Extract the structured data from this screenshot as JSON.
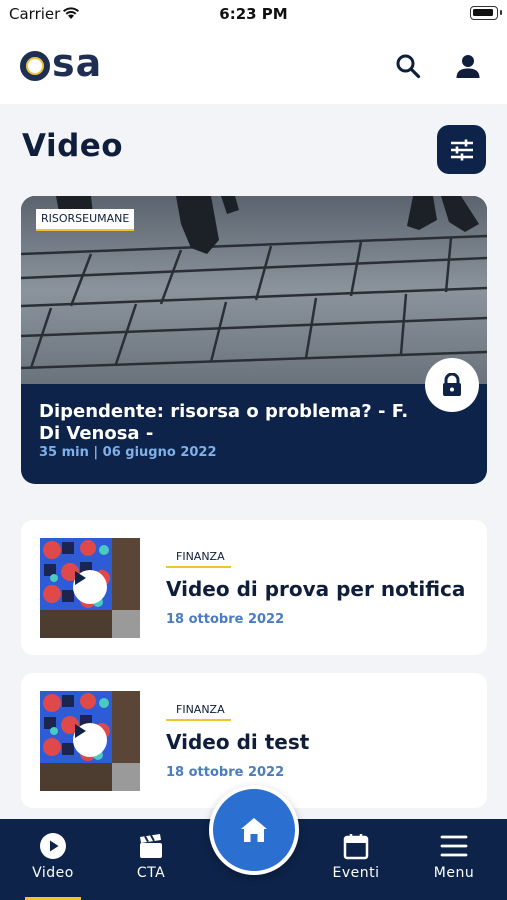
{
  "status_bar": {
    "carrier": "Carrier",
    "time": "6:23 PM"
  },
  "header": {
    "logo_text": "sa"
  },
  "page": {
    "title": "Video"
  },
  "featured": {
    "tag": "RISORSEUMANE",
    "title": "Dipendente: risorsa o problema? - F. Di Venosa -",
    "meta": "35 min  |  06 giugno 2022",
    "locked": true
  },
  "videos": [
    {
      "tag": "FINANZA",
      "title": "Video di prova per notifica",
      "date": "18 ottobre 2022"
    },
    {
      "tag": "FINANZA",
      "title": "Video di test",
      "date": "18 ottobre 2022"
    }
  ],
  "tab_bar": {
    "items": [
      {
        "label": "Video",
        "icon": "play-circle-icon",
        "active": true
      },
      {
        "label": "CTA",
        "icon": "clapperboard-icon",
        "active": false
      },
      {
        "label": "",
        "icon": "home-icon",
        "active": false
      },
      {
        "label": "Eventi",
        "icon": "calendar-icon",
        "active": false
      },
      {
        "label": "Menu",
        "icon": "hamburger-menu-icon",
        "active": false
      }
    ]
  },
  "colors": {
    "navy": "#0d2349",
    "accent_yellow": "#f2c230",
    "date_blue": "#4a7cc0",
    "home_blue": "#2b6fd0"
  }
}
